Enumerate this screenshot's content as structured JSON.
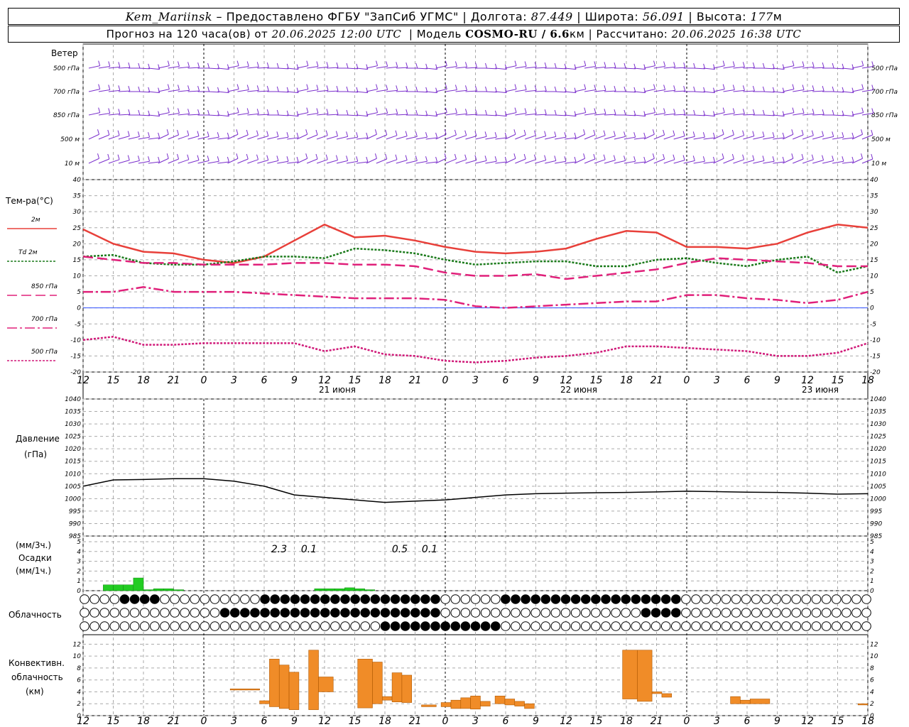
{
  "header": {
    "station": "Kem_Mariinsk",
    "provider_prefix": "Предоставлено ФГБУ",
    "provider": "\"ЗапСиб УГМС\"",
    "lon_label": "Долгота:",
    "lon": "87.449",
    "lat_label": "Широта:",
    "lat": "56.091",
    "alt_label": "Высота:",
    "alt": "177",
    "alt_unit": "м",
    "forecast_prefix": "Прогноз на 120 часа(ов) от",
    "forecast_from": "20.06.2025 12:00 UTC",
    "model_label": "Модель",
    "model": "COSMO-RU / 6.6",
    "model_unit": "км",
    "calc_label": "Рассчитано:",
    "calc": "20.06.2025 16:38 UTC"
  },
  "panels": {
    "wind": {
      "title": "Ветер",
      "levels": [
        "500 гПа",
        "700 гПа",
        "850 гПа",
        "500 м",
        "10  м"
      ]
    },
    "temp": {
      "title": "Тем-ра(°C)",
      "legend": [
        {
          "label": "2м",
          "color": "#e8403a",
          "dash": "solid"
        },
        {
          "label": "Td  2м",
          "color": "#1a7a1a",
          "dash": "dot"
        },
        {
          "label": "850 гПа",
          "color": "#e0207a",
          "dash": "long"
        },
        {
          "label": "700 гПа",
          "color": "#e0207a",
          "dash": "dashdot"
        },
        {
          "label": "500 гПа",
          "color": "#d01878",
          "dash": "dot"
        }
      ],
      "yticks": [
        "40",
        "35",
        "30",
        "25",
        "20",
        "15",
        "10",
        "5",
        "0",
        "-5",
        "-10",
        "-15",
        "-20"
      ]
    },
    "pressure": {
      "title1": "Давление",
      "title2": "(гПа)",
      "yticks": [
        "1040",
        "1035",
        "1030",
        "1025",
        "1020",
        "1015",
        "1010",
        "1005",
        "1000",
        "995",
        "990",
        "985"
      ]
    },
    "precip": {
      "title1": "(мм/3ч.)",
      "title2": "Осадки",
      "title3": "(мм/1ч.)",
      "yticks": [
        "5",
        "4",
        "3",
        "2",
        "1",
        "0"
      ],
      "annotations": [
        "2.3",
        "0.1",
        "0.5",
        "0.1"
      ]
    },
    "cloud": {
      "title": "Облачность"
    },
    "convective": {
      "title1": "Конвективн.",
      "title2": "облачность",
      "title3": "(км)",
      "yticks": [
        "12",
        "10",
        "8",
        "6",
        "4",
        "2",
        "0"
      ]
    }
  },
  "x_ticks": [
    "12",
    "15",
    "18",
    "21",
    "0",
    "3",
    "6",
    "9",
    "12",
    "15",
    "18",
    "21",
    "0",
    "3",
    "6",
    "9",
    "12",
    "15",
    "18",
    "21",
    "0",
    "3",
    "6",
    "9",
    "12",
    "15",
    "18"
  ],
  "dates": [
    "21 июня",
    "22 июня",
    "23 июня"
  ],
  "chart_data": [
    {
      "type": "line",
      "title": "Тем-ра(°C)",
      "x_hours": [
        0,
        3,
        6,
        9,
        12,
        15,
        18,
        21,
        24,
        27,
        30,
        33,
        36,
        39,
        42,
        45,
        48,
        51,
        54,
        57,
        60,
        63,
        66,
        69,
        72,
        75,
        78
      ],
      "ylim": [
        -20,
        40
      ],
      "series": [
        {
          "name": "2м",
          "values": [
            24.5,
            20,
            17.5,
            17,
            15,
            14,
            16,
            21,
            26,
            22,
            22.5,
            21,
            19,
            17.5,
            17,
            17.5,
            18.5,
            21.5,
            24,
            23.5,
            19,
            19,
            18.5,
            20,
            23.5,
            26,
            25
          ]
        },
        {
          "name": "Td  2м",
          "values": [
            16,
            16.5,
            14,
            13.5,
            13.5,
            14.5,
            16,
            16,
            15.5,
            18.5,
            18,
            17,
            15,
            13.5,
            14,
            14.5,
            14.5,
            13,
            13,
            15,
            15.5,
            14,
            13,
            15,
            16,
            11,
            13
          ]
        },
        {
          "name": "850 гПа",
          "values": [
            16,
            15,
            14,
            14,
            13.5,
            13.5,
            13.5,
            14,
            14,
            13.5,
            13.5,
            13,
            11,
            10,
            10,
            10.5,
            9,
            10,
            11,
            12,
            14,
            15.5,
            15,
            14.5,
            14,
            13,
            13
          ]
        },
        {
          "name": "700 гПа",
          "values": [
            5,
            5,
            6.5,
            5,
            5,
            5,
            4.5,
            4,
            3.5,
            3,
            3,
            3,
            2.5,
            0.5,
            0,
            0.5,
            1,
            1.5,
            2,
            2,
            4,
            4,
            3,
            2.5,
            1.5,
            2.5,
            5
          ]
        },
        {
          "name": "500 гПа",
          "values": [
            -10,
            -9,
            -11.5,
            -11.5,
            -11,
            -11,
            -11,
            -11,
            -13.5,
            -12,
            -14.5,
            -15,
            -16.5,
            -17,
            -16.5,
            -15.5,
            -15,
            -14,
            -12,
            -12,
            -12.5,
            -13,
            -13.5,
            -15,
            -15,
            -14,
            -11
          ]
        }
      ]
    },
    {
      "type": "line",
      "title": "Давление (гПа)",
      "x_hours": [
        0,
        3,
        6,
        9,
        12,
        15,
        18,
        21,
        24,
        27,
        30,
        33,
        36,
        39,
        42,
        45,
        48,
        51,
        54,
        57,
        60,
        63,
        66,
        69,
        72,
        75,
        78
      ],
      "ylim": [
        985,
        1040
      ],
      "series": [
        {
          "name": "Давление",
          "values": [
            1005,
            1007.5,
            1007.7,
            1008,
            1008,
            1007,
            1005,
            1001.5,
            1000.5,
            999.5,
            998.5,
            999,
            999.5,
            1000.5,
            1001.5,
            1002,
            1002.2,
            1002.4,
            1002.5,
            1002.7,
            1003,
            1002.8,
            1002.6,
            1002.5,
            1002.2,
            1001.8,
            1002
          ]
        }
      ]
    },
    {
      "type": "bar",
      "title": "Осадки (мм/1ч.)",
      "x_hours": [
        36,
        37,
        38,
        39,
        40,
        41,
        42,
        43,
        57,
        58,
        59,
        60,
        61,
        62
      ],
      "ylim": [
        0,
        5
      ],
      "values": [
        0.6,
        0.6,
        0.6,
        1.3,
        0.1,
        0.2,
        0.2,
        0.1,
        0.2,
        0.2,
        0.2,
        0.3,
        0.2,
        0.1
      ]
    },
    {
      "type": "bar",
      "title": "Конвективн. облачность (км)",
      "ylim": [
        0,
        13
      ],
      "segments_hours_km": [
        [
          30,
          36,
          4.5,
          4.3
        ],
        [
          36,
          38,
          2.5,
          2.0
        ],
        [
          38,
          40,
          9.5,
          1.5
        ],
        [
          40,
          42,
          8.5,
          1.2
        ],
        [
          42,
          44,
          7.3,
          1.0
        ],
        [
          46,
          48,
          11,
          1.0
        ],
        [
          48,
          51,
          6.5,
          4.0
        ],
        [
          56,
          59,
          9.5,
          1.3
        ],
        [
          59,
          61,
          9,
          2.0
        ],
        [
          61,
          63,
          3.2,
          2.6
        ],
        [
          63,
          65,
          7.2,
          2.3
        ],
        [
          65,
          67,
          6.8,
          2.2
        ],
        [
          69,
          72,
          1.8,
          1.5
        ],
        [
          73,
          75,
          2.2,
          1.5
        ],
        [
          75,
          77,
          2.6,
          1.2
        ],
        [
          77,
          79,
          3.0,
          1.2
        ],
        [
          79,
          81,
          3.3,
          1.1
        ],
        [
          81,
          83,
          2.4,
          1.6
        ],
        [
          84,
          86,
          3.3,
          2.0
        ],
        [
          86,
          88,
          2.8,
          1.8
        ],
        [
          88,
          90,
          2.4,
          1.6
        ],
        [
          90,
          92,
          2.0,
          1.2
        ],
        [
          110,
          113,
          11,
          2.8
        ],
        [
          113,
          116,
          11,
          2.4
        ],
        [
          116,
          118,
          4.0,
          3.7
        ],
        [
          118,
          120,
          3.7,
          3.1
        ],
        [
          132,
          134,
          3.2,
          2.0
        ],
        [
          134,
          136,
          2.6,
          2.0
        ],
        [
          136,
          140,
          2.8,
          2.0
        ],
        [
          158,
          160,
          2.0,
          1.8
        ]
      ]
    }
  ]
}
